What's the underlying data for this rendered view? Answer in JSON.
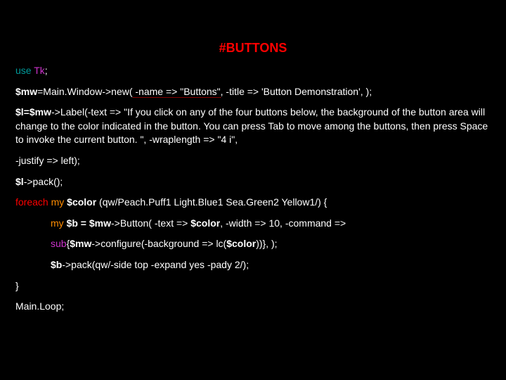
{
  "title": "#BUTTONS",
  "l1_use": "use ",
  "l1_tk": "Tk",
  "l1_semi": ";",
  "l2_a": "$mw",
  "l2_b": "=Main.Window->new(",
  "l2_c": " -name => \"Buttons\"",
  "l2_d": ", -title => 'Button Demonstration', );",
  "l3_a": "$l=$mw",
  "l3_b": "->Label(-text => \"If you click on any of the four buttons below, the background of the button area will change to the color indicated in the button. You can press Tab to move among the buttons, then press Space to invoke the current button. \", -wraplength => \"4 i\",",
  "l4": " -justify => left);",
  "l5_a": " $l",
  "l5_b": "->pack();",
  "l6_a": "foreach",
  "l6_b": " my ",
  "l6_c": "$color",
  "l6_d": " (qw/Peach.Puff1 Light.Blue1 Sea.Green2 Yellow1/) {",
  "l7_a": " my ",
  "l7_b": "$b = $mw",
  "l7_c": "->Button( -text => ",
  "l7_d": "$color",
  "l7_e": ", -width => 10, -command =>",
  "l8_a": "sub",
  "l8_b": "{",
  "l8_c": "$mw",
  "l8_d": "->configure(-background => lc(",
  "l8_e": "$color",
  "l8_f": "))}, );",
  "l9_a": " $b",
  "l9_b": "->pack(qw/-side top -expand yes -pady 2/);",
  "l10": " }",
  "l11": "Main.Loop;"
}
